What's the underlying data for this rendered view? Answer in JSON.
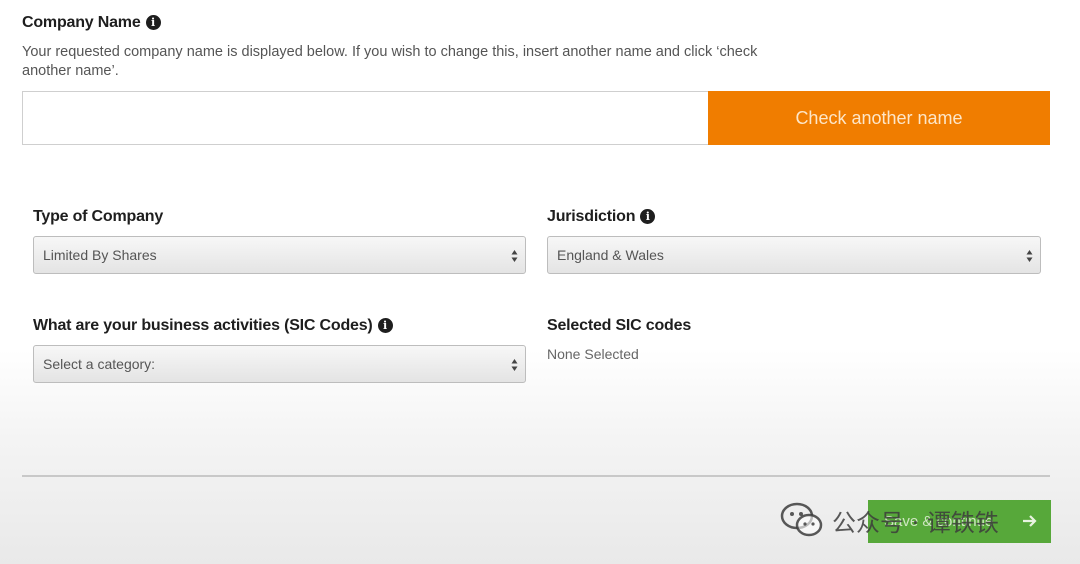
{
  "company_name": {
    "heading": "Company Name",
    "description": "Your requested company name is displayed below. If you wish to change this, insert another name and click ‘check another name’.",
    "input_value": "",
    "check_button": "Check another name"
  },
  "type_of_company": {
    "label": "Type of Company",
    "selected": "Limited By Shares"
  },
  "jurisdiction": {
    "label": "Jurisdiction",
    "selected": "England & Wales"
  },
  "business_activities": {
    "label": "What are your business activities (SIC Codes)",
    "selected": "Select a category:"
  },
  "selected_sic": {
    "label": "Selected SIC codes",
    "value": "None Selected"
  },
  "footer": {
    "save_button": "Save & continue"
  },
  "watermark": {
    "text": "公众号 · 谭铁铁"
  },
  "colors": {
    "accent_orange": "#f07d00",
    "accent_green": "#57a83a"
  },
  "icons": [
    "info-icon",
    "select-arrows-icon",
    "arrow-right-icon",
    "wechat-icon"
  ]
}
